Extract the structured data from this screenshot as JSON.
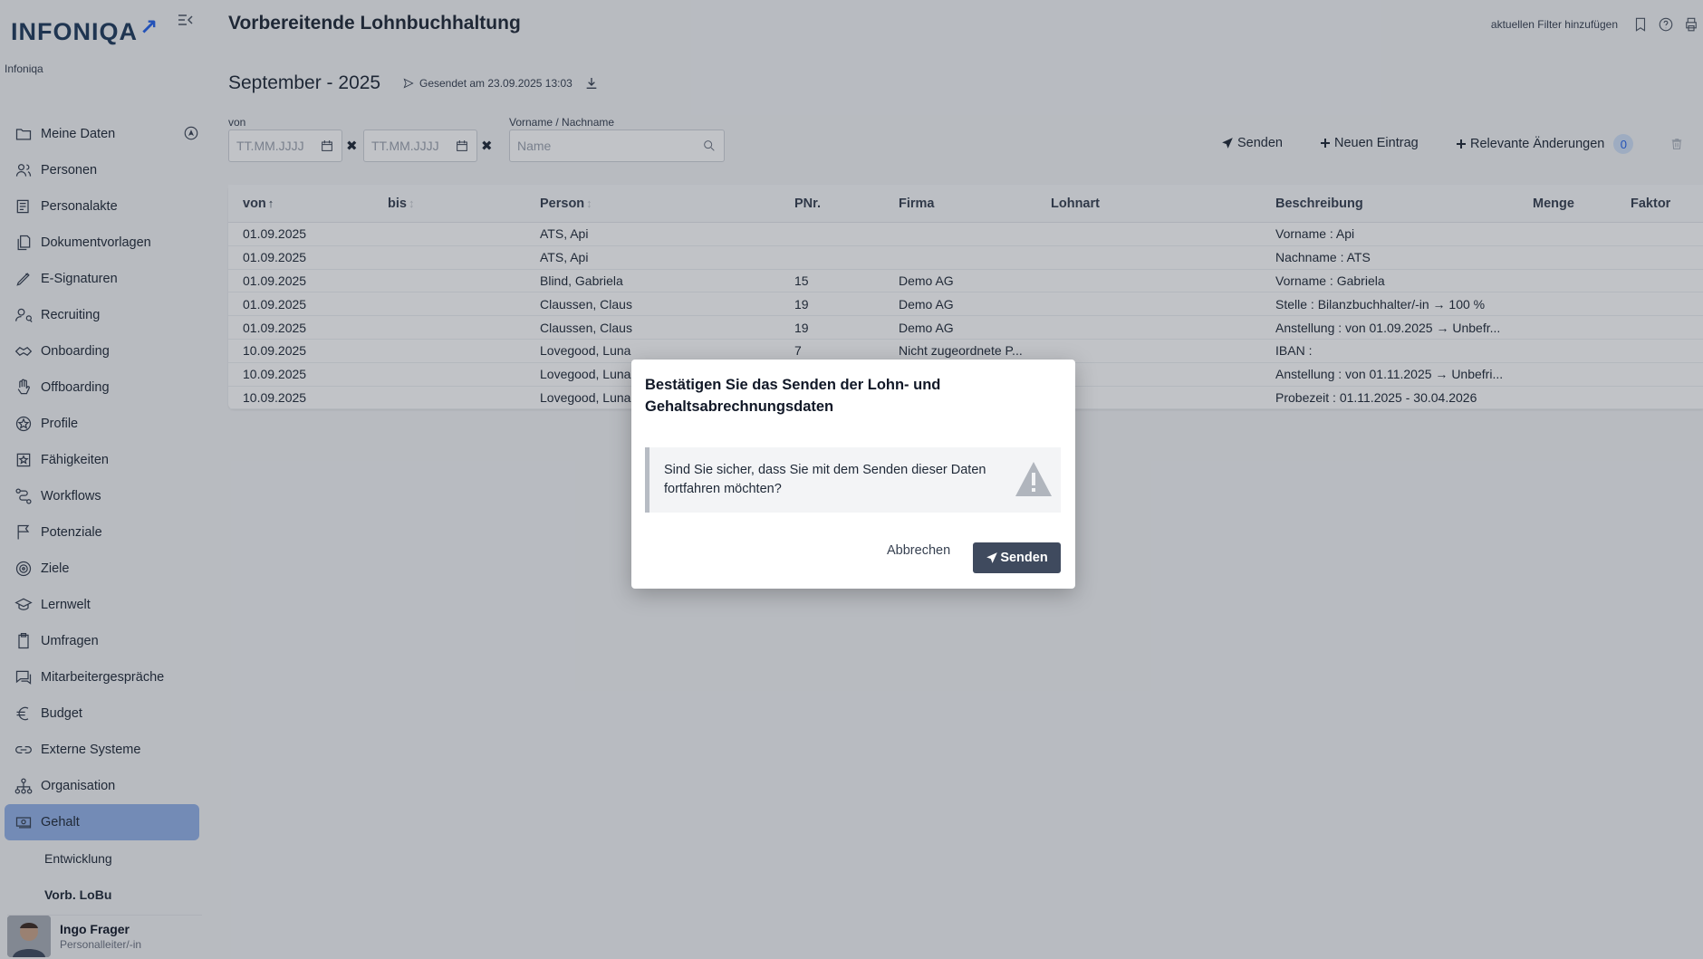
{
  "app": {
    "logo_text": "INFONIQA",
    "tenant": "Infoniqa"
  },
  "sidebar": {
    "items": [
      {
        "label": "Meine Daten",
        "icon": "folder-icon"
      },
      {
        "label": "Personen",
        "icon": "people-icon"
      },
      {
        "label": "Personalakte",
        "icon": "file-list-icon"
      },
      {
        "label": "Dokumentvorlagen",
        "icon": "document-copy-icon"
      },
      {
        "label": "E-Signaturen",
        "icon": "pen-icon"
      },
      {
        "label": "Recruiting",
        "icon": "user-search-icon"
      },
      {
        "label": "Onboarding",
        "icon": "handshake-icon"
      },
      {
        "label": "Offboarding",
        "icon": "hand-icon"
      },
      {
        "label": "Profile",
        "icon": "star-badge-icon"
      },
      {
        "label": "Fähigkeiten",
        "icon": "star-box-icon"
      },
      {
        "label": "Workflows",
        "icon": "workflow-icon"
      },
      {
        "label": "Potenziale",
        "icon": "flag-icon"
      },
      {
        "label": "Ziele",
        "icon": "target-icon"
      },
      {
        "label": "Lernwelt",
        "icon": "graduation-icon"
      },
      {
        "label": "Umfragen",
        "icon": "clipboard-icon"
      },
      {
        "label": "Mitarbeitergespräche",
        "icon": "chat-icon"
      },
      {
        "label": "Budget",
        "icon": "euro-icon"
      },
      {
        "label": "Externe Systeme",
        "icon": "link-icon"
      },
      {
        "label": "Organisation",
        "icon": "org-chart-icon"
      },
      {
        "label": "Gehalt",
        "icon": "money-icon"
      }
    ],
    "sub_items": [
      {
        "label": "Entwicklung"
      },
      {
        "label": "Vorb. LoBu"
      }
    ]
  },
  "user": {
    "name": "Ingo Frager",
    "role": "Personalleiter/-in"
  },
  "header": {
    "title": "Vorbereitende Lohnbuchhaltung",
    "add_filter": "aktuellen Filter hinzufügen"
  },
  "period": {
    "label": "September - 2025",
    "sent_info": "Gesendet am 23.09.2025 13:03"
  },
  "filters": {
    "von_label": "von",
    "date_placeholder": "TT.MM.JJJJ",
    "name_label": "Vorname / Nachname",
    "name_placeholder": "Name"
  },
  "toolbar": {
    "send": "Senden",
    "new_entry": "Neuen Eintrag",
    "relevant_changes": "Relevante Änderungen",
    "relevant_count": "0"
  },
  "table": {
    "columns": {
      "von": "von",
      "bis": "bis",
      "person": "Person",
      "pnr": "PNr.",
      "firma": "Firma",
      "lohnart": "Lohnart",
      "beschreibung": "Beschreibung",
      "menge": "Menge",
      "faktor": "Faktor"
    },
    "rows": [
      {
        "von": "01.09.2025",
        "bis": "",
        "person": "ATS, Api",
        "pnr": "",
        "firma": "",
        "beschreibung": "Vorname : Api"
      },
      {
        "von": "01.09.2025",
        "bis": "",
        "person": "ATS, Api",
        "pnr": "",
        "firma": "",
        "beschreibung": "Nachname : ATS"
      },
      {
        "von": "01.09.2025",
        "bis": "",
        "person": "Blind, Gabriela",
        "pnr": "15",
        "firma": "Demo AG",
        "beschreibung": "Vorname : Gabriela"
      },
      {
        "von": "01.09.2025",
        "bis": "",
        "person": "Claussen, Claus",
        "pnr": "19",
        "firma": "Demo AG",
        "beschreibung": "Stelle : Bilanzbuchhalter/-in → 100 %"
      },
      {
        "von": "01.09.2025",
        "bis": "",
        "person": "Claussen, Claus",
        "pnr": "19",
        "firma": "Demo AG",
        "beschreibung": "Anstellung : von 01.09.2025 → Unbefr..."
      },
      {
        "von": "10.09.2025",
        "bis": "",
        "person": "Lovegood, Luna",
        "pnr": "7",
        "firma": "Nicht zugeordnete P...",
        "beschreibung": "IBAN :"
      },
      {
        "von": "10.09.2025",
        "bis": "",
        "person": "Lovegood, Luna",
        "pnr": "",
        "firma": "",
        "beschreibung": "Anstellung : von 01.11.2025 → Unbefri..."
      },
      {
        "von": "10.09.2025",
        "bis": "",
        "person": "Lovegood, Luna",
        "pnr": "",
        "firma": "",
        "beschreibung": "Probezeit : 01.11.2025 - 30.04.2026"
      }
    ]
  },
  "modal": {
    "title": "Bestätigen Sie das Senden der Lohn- und Gehaltsabrechnungsdaten",
    "message": "Sind Sie sicher, dass Sie mit dem Senden dieser Daten fortfahren möchten?",
    "cancel": "Abbrechen",
    "confirm": "Senden"
  },
  "colors": {
    "active_nav": "#93b2e8",
    "primary_button": "#3f4a5e",
    "badge_bg": "#cfe0f7",
    "badge_text": "#2563eb"
  }
}
